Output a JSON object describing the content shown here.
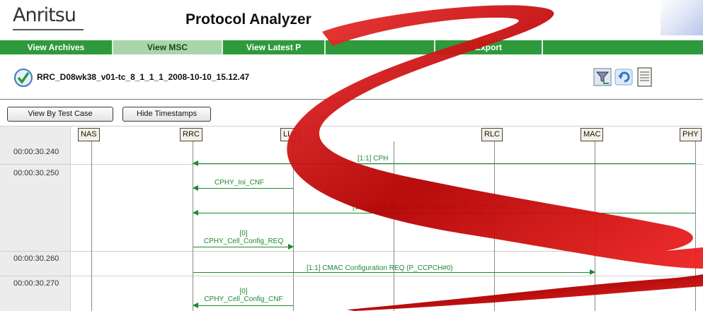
{
  "header": {
    "brand": "Anritsu",
    "title": "Protocol Analyzer"
  },
  "nav": [
    {
      "label": "View Archives",
      "active": false
    },
    {
      "label": "View MSC",
      "active": true
    },
    {
      "label": "View Latest P",
      "active": false
    },
    {
      "label": "",
      "active": false
    },
    {
      "label": "Export",
      "active": false
    },
    {
      "label": "",
      "active": false
    }
  ],
  "test": {
    "name": "RRC_D08wk38_v01-tc_8_1_1_1_2008-10-10_15.12.47"
  },
  "toolbar": {
    "icons": [
      "filter-icon",
      "refresh-icon",
      "document-icon"
    ]
  },
  "buttons": {
    "view_by_test_case": "View By Test Case",
    "hide_timestamps": "Hide Timestamps"
  },
  "msc": {
    "entities": [
      "NAS",
      "RRC",
      "LLA",
      "RLC",
      "MAC",
      "PHY"
    ],
    "timestamps": [
      "00:00:30.240",
      "00:00:30.250",
      "00:00:30.260",
      "00:00:30.270"
    ],
    "messages": [
      {
        "label": "[1:1] CPH",
        "from": "PHY",
        "to": "RRC"
      },
      {
        "label": "CPHY_Ini_CNF",
        "from": "LLA",
        "to": "RRC"
      },
      {
        "label": "[1:1] CPHY Radio Link Setup CNF (P_CCPCH#0)",
        "from": "PHY",
        "to": "RRC"
      },
      {
        "label_line1": "[0]",
        "label_line2": "CPHY_Cell_Config_REQ",
        "from": "RRC",
        "to": "LLA"
      },
      {
        "label": "[1:1] CMAC Configuration REQ (P_CCPCH#0)",
        "from": "RRC",
        "to": "MAC"
      },
      {
        "label_line1": "[0]",
        "label_line2": "CPHY_Cell_Config_CNF",
        "from": "LLA",
        "to": "RRC"
      }
    ]
  },
  "colors": {
    "nav_green": "#2f9a3c",
    "nav_active": "#a9d6a9",
    "message_green": "#1c8a2e",
    "ribbon_red": "#cc1111"
  }
}
